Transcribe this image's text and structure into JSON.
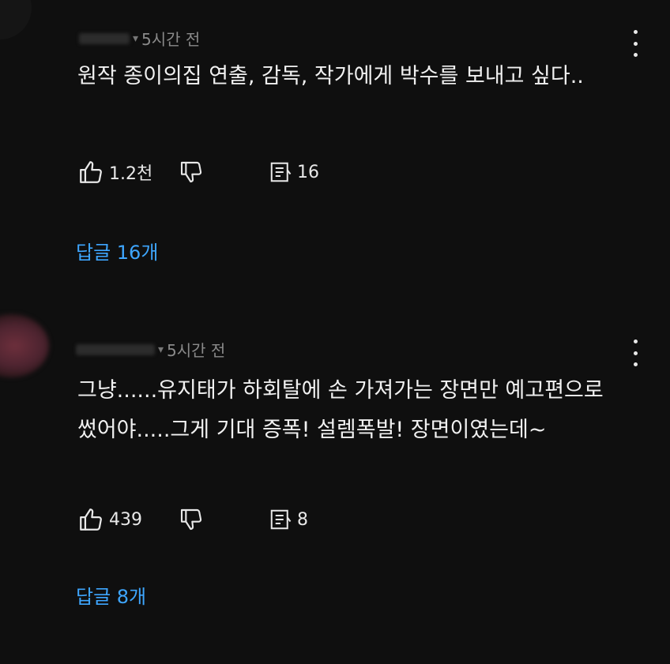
{
  "comments": [
    {
      "time": "5시간 전",
      "text": "원작 종이의집 연출, 감독, 작가에게 박수를 보내고 싶다..",
      "likes": "1.2천",
      "reply_count": "16",
      "replies_link": "답글 16개"
    },
    {
      "time": "5시간 전",
      "text": "그냥......유지태가 하회탈에 손 가져가는 장면만 예고편으로 썼어야.....그게 기대 증폭! 설렘폭발! 장면이였는데~",
      "likes": "439",
      "reply_count": "8",
      "replies_link": "답글 8개"
    }
  ],
  "icons": {
    "like": "thumbs-up-icon",
    "dislike": "thumbs-down-icon",
    "reply": "reply-icon",
    "menu": "more-vert-icon"
  },
  "colors": {
    "background": "#0f0f0f",
    "text": "#f1f1f1",
    "meta": "#8a8a8a",
    "link": "#3ea6ff"
  }
}
